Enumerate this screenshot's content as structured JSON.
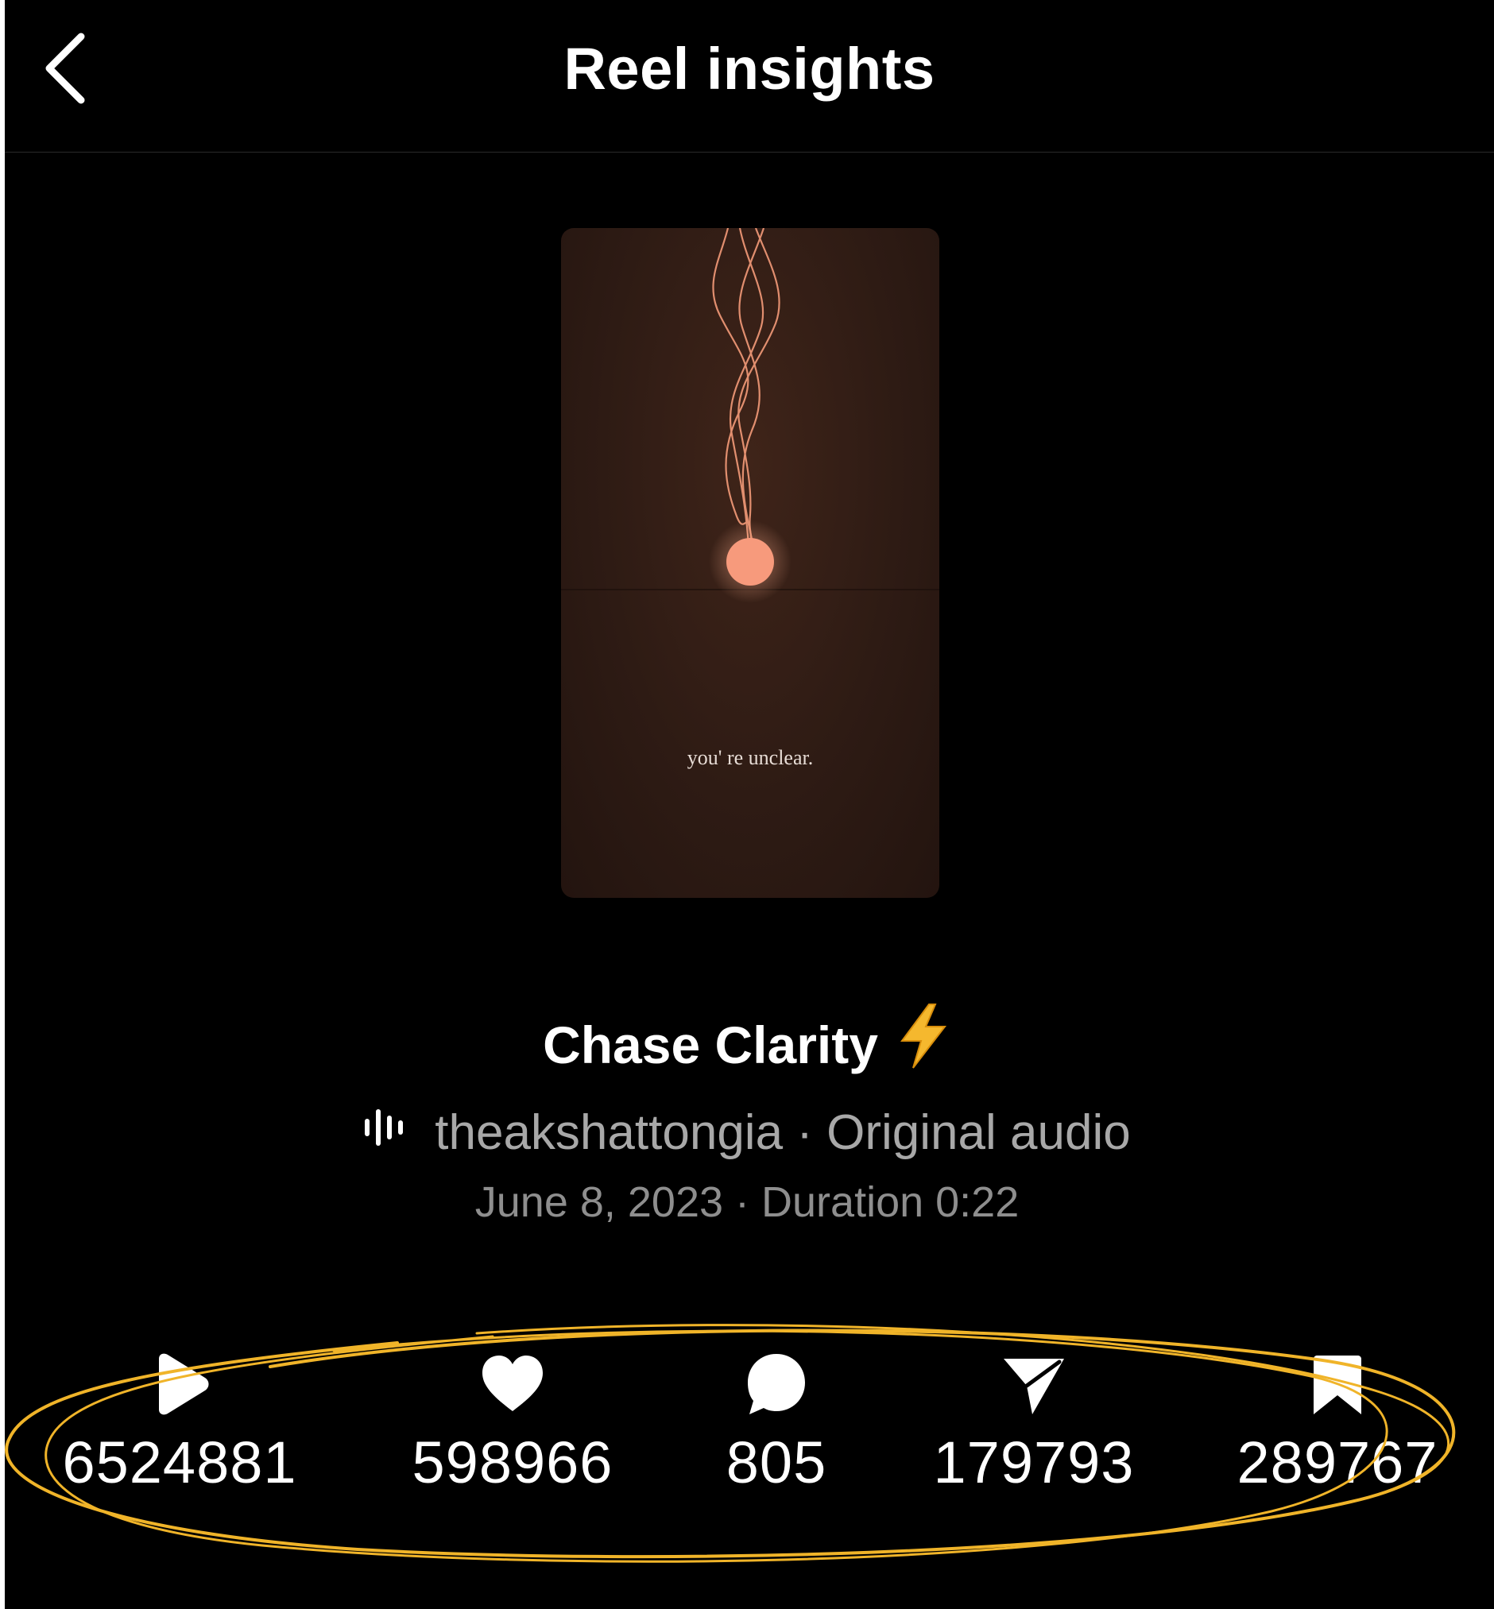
{
  "header": {
    "title": "Reel insights",
    "back_icon": "chevron-left-icon"
  },
  "reel": {
    "thumbnail_caption": "you' re unclear.",
    "title": "Chase Clarity",
    "title_emoji": "high-voltage-icon",
    "audio_icon": "audio-wave-icon",
    "audio_text": "theakshattongia · Original audio",
    "date_text": "June 8, 2023 · Duration 0:22"
  },
  "stats": [
    {
      "icon": "play-icon",
      "value": "6524881"
    },
    {
      "icon": "heart-icon",
      "value": "598966"
    },
    {
      "icon": "comment-icon",
      "value": "805"
    },
    {
      "icon": "share-icon",
      "value": "179793"
    },
    {
      "icon": "bookmark-icon",
      "value": "289767"
    }
  ],
  "colors": {
    "background": "#000000",
    "accent_circle": "#F0B429",
    "thumbnail_bg": "#2e1b14",
    "orb": "#F79A7C",
    "bolt": "#F5B82E"
  }
}
